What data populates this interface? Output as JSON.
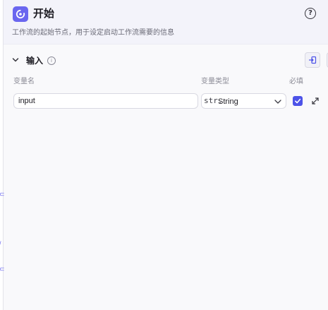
{
  "node": {
    "title": "开始",
    "description": "工作流的起始节点，用于设定启动工作流需要的信息",
    "icon": "start-node-icon",
    "accent_color": "#6a66ef"
  },
  "header": {
    "help_symbol": "?"
  },
  "inputs_section": {
    "title": "输入",
    "info_symbol": "i",
    "columns": {
      "name": "变量名",
      "type": "变量类型",
      "required": "必填"
    },
    "rows": [
      {
        "name": "input",
        "type_prefix": "str.",
        "type": "String",
        "required": true
      }
    ]
  },
  "colors": {
    "checkbox": "#4d53e8",
    "panel_background": "#f9f9fb",
    "header_background": "#f3f3fa"
  }
}
